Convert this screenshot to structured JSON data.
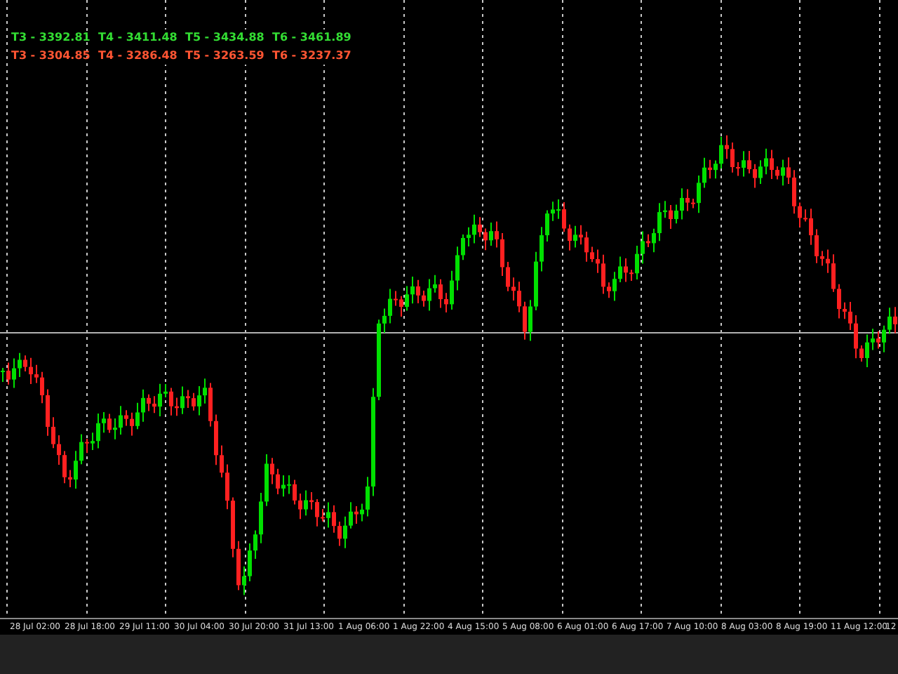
{
  "targets_upper": [
    "T3 - 3392.81",
    "T4 - 3411.48",
    "T5 - 3434.88",
    "T6 - 3461.89"
  ],
  "targets_lower": [
    "T3 - 3304.85",
    "T4 - 3286.48",
    "T5 - 3263.59",
    "T6 - 3237.37"
  ],
  "time_axis": [
    "28 Jul 02:00",
    "28 Jul 18:00",
    "29 Jul 11:00",
    "30 Jul 04:00",
    "30 Jul 20:00",
    "31 Jul 13:00",
    "1 Aug 06:00",
    "1 Aug 22:00",
    "4 Aug 15:00",
    "5 Aug 08:00",
    "6 Aug 01:00",
    "6 Aug 17:00",
    "7 Aug 10:00",
    "8 Aug 03:00",
    "8 Aug 19:00",
    "11 Aug 12:00",
    "12"
  ]
}
